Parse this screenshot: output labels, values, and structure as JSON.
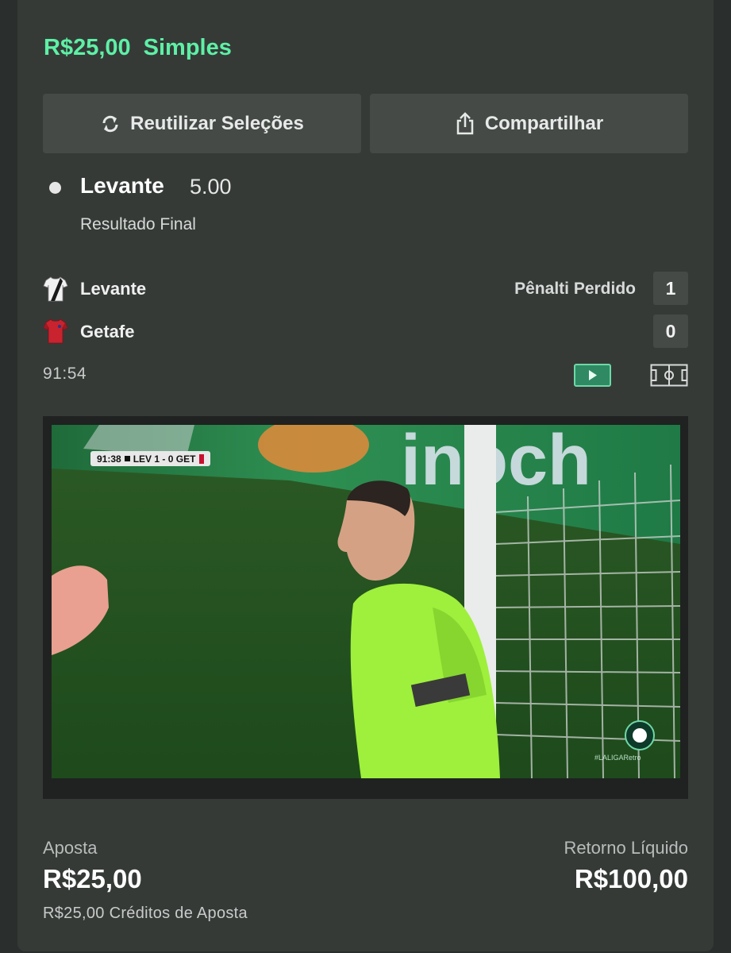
{
  "header": {
    "amount": "R$25,00",
    "bet_type": "Simples"
  },
  "actions": {
    "reuse_label": "Reutilizar Seleções",
    "share_label": "Compartilhar"
  },
  "selection": {
    "team": "Levante",
    "odds": "5.00",
    "market": "Resultado Final"
  },
  "match": {
    "home": {
      "name": "Levante",
      "score": "1",
      "event": "Pênalti Perdido"
    },
    "away": {
      "name": "Getafe",
      "score": "0"
    },
    "clock": "91:54"
  },
  "video": {
    "scorebug": {
      "time": "91:38",
      "home": "LEV",
      "score": "1 - 0",
      "away": "GET"
    },
    "watermark": "#LALIGARetro"
  },
  "summary": {
    "stake_label": "Aposta",
    "stake_value": "R$25,00",
    "credits": "R$25,00 Créditos de Aposta",
    "return_label": "Retorno Líquido",
    "return_value": "R$100,00"
  },
  "colors": {
    "accent": "#5ef0a6",
    "card": "#353a37",
    "button": "#454a47",
    "play": "#2f8a64"
  }
}
